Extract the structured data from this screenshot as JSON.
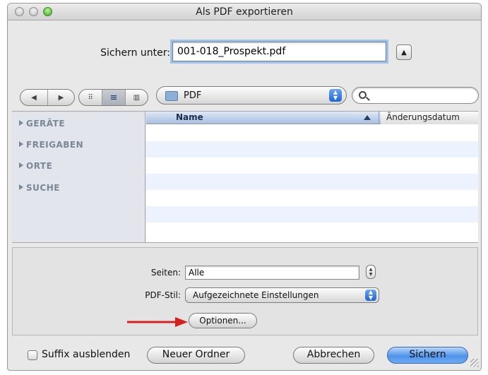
{
  "window": {
    "title": "Als PDF exportieren"
  },
  "save": {
    "label": "Sichern unter:",
    "filename": "001-018_Prospekt.pdf",
    "expand_icon": "triangle-up-icon"
  },
  "toolbar": {
    "nav": {
      "back_icon": "chevron-left-icon",
      "forward_icon": "chevron-right-icon"
    },
    "views": {
      "icon_view": "icon-view-icon",
      "list_view": "list-view-icon",
      "column_view": "column-view-icon",
      "active": "list"
    },
    "folder": {
      "name": "PDF",
      "icon": "folder-icon"
    },
    "search": {
      "value": "",
      "icon": "search-icon"
    }
  },
  "sidebar": {
    "items": [
      {
        "label": "GERÄTE"
      },
      {
        "label": "FREIGABEN"
      },
      {
        "label": "ORTE"
      },
      {
        "label": "SUCHE"
      }
    ]
  },
  "filelist": {
    "columns": {
      "name": "Name",
      "date": "Änderungsdatum"
    },
    "sort": "ascending"
  },
  "options": {
    "pages_label": "Seiten:",
    "pages_value": "Alle",
    "style_label": "PDF-Stil:",
    "style_value": "Aufgezeichnete Einstellungen",
    "options_button": "Optionen..."
  },
  "footer": {
    "hide_suffix": "Suffix ausblenden",
    "hide_suffix_checked": false,
    "new_folder": "Neuer Ordner",
    "cancel": "Abbrechen",
    "save": "Sichern"
  },
  "colors": {
    "accent": "#4f93ea",
    "annotation_arrow": "#d62020"
  }
}
